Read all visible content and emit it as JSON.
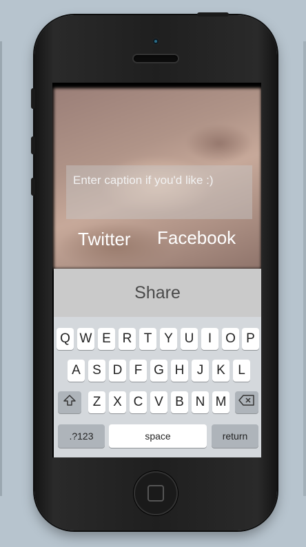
{
  "caption": {
    "placeholder": "Enter caption if you'd like :)"
  },
  "share_targets": {
    "twitter": "Twitter",
    "facebook": "Facebook"
  },
  "share_button": {
    "label": "Share"
  },
  "keyboard": {
    "row1": [
      "Q",
      "W",
      "E",
      "R",
      "T",
      "Y",
      "U",
      "I",
      "O",
      "P"
    ],
    "row2": [
      "A",
      "S",
      "D",
      "F",
      "G",
      "H",
      "J",
      "K",
      "L"
    ],
    "row3": [
      "Z",
      "X",
      "C",
      "V",
      "B",
      "N",
      "M"
    ],
    "numbers_key": ".?123",
    "space_key": "space",
    "return_key": "return",
    "shift_icon": "shift-icon",
    "delete_icon": "backspace-icon"
  },
  "colors": {
    "share_bar": "#cacaca",
    "keyboard_bg": "#d4d8dc",
    "phone_body": "#1f1f1f"
  }
}
